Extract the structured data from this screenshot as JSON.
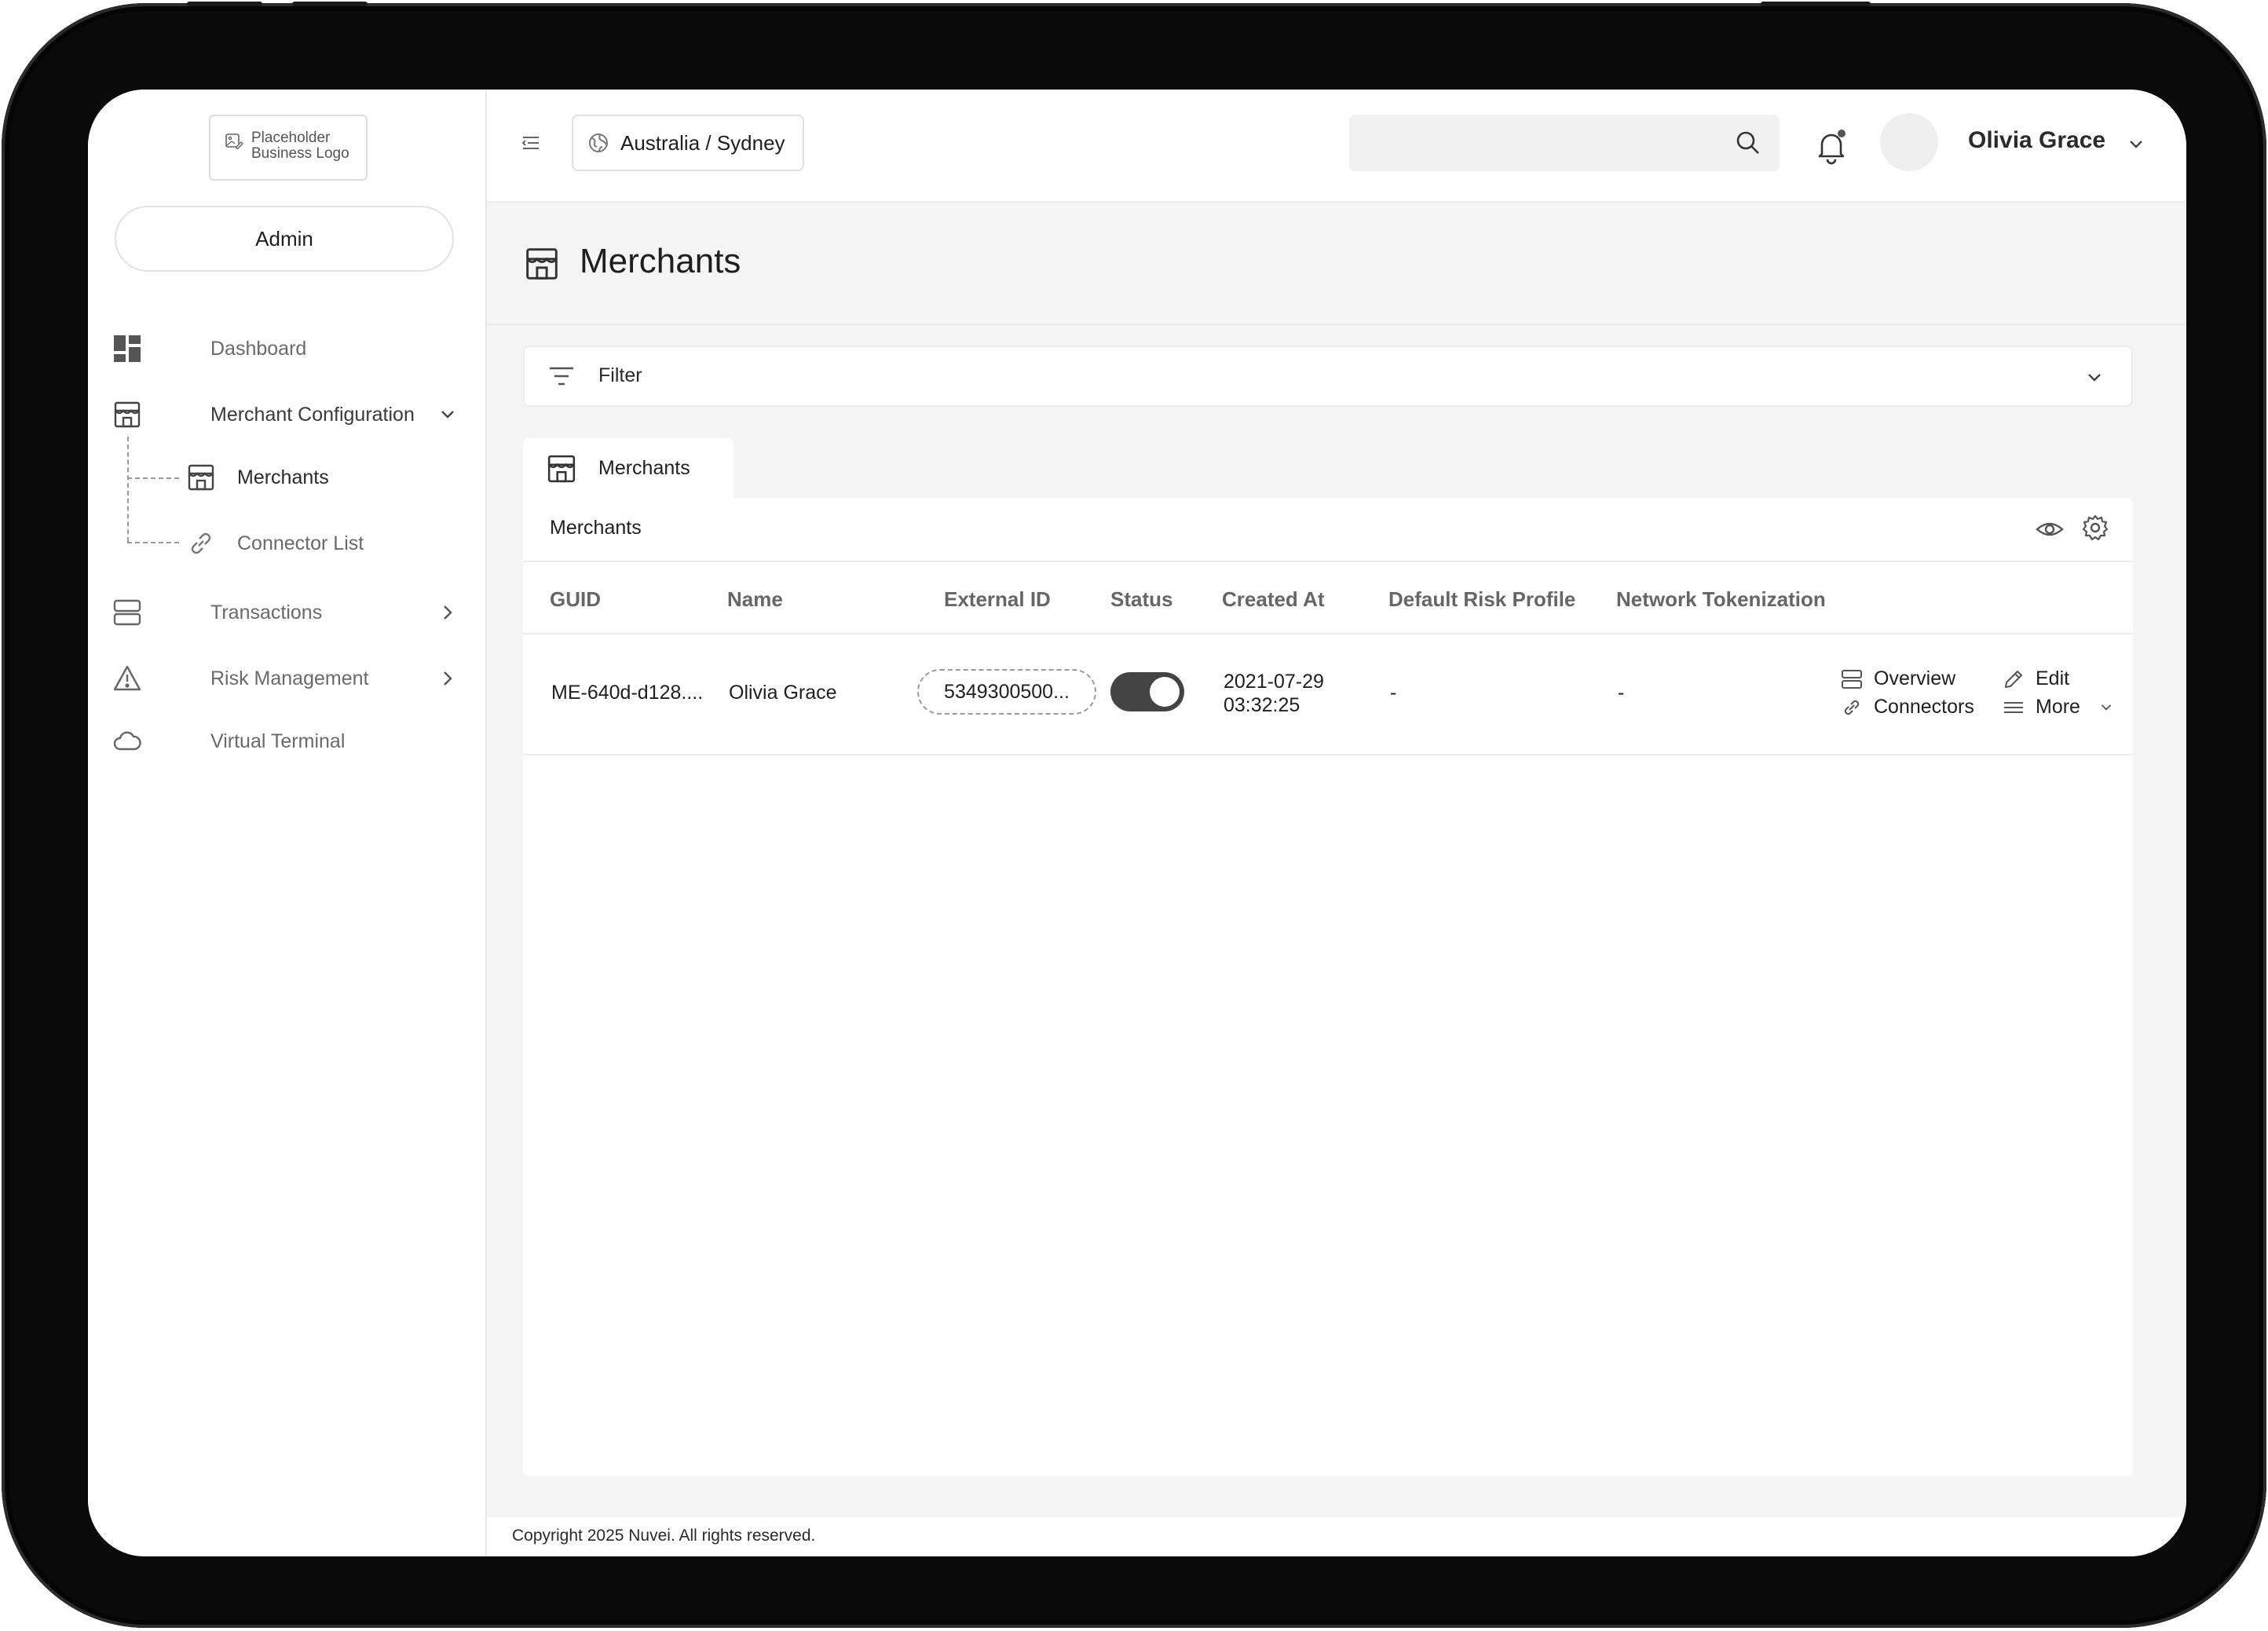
{
  "sidebar": {
    "logo_line1": "Placeholder",
    "logo_line2": "Business Logo",
    "role": "Admin",
    "items": [
      {
        "label": "Dashboard",
        "icon": "dashboard-icon"
      },
      {
        "label": "Merchant Configuration",
        "icon": "store-icon",
        "expanded": true,
        "children": [
          {
            "label": "Merchants",
            "icon": "store-icon",
            "active": true
          },
          {
            "label": "Connector List",
            "icon": "link-icon"
          }
        ]
      },
      {
        "label": "Transactions",
        "icon": "transactions-icon"
      },
      {
        "label": "Risk Management",
        "icon": "warning-icon"
      },
      {
        "label": "Virtual Terminal",
        "icon": "cloud-icon"
      }
    ]
  },
  "header": {
    "timezone": "Australia / Sydney",
    "search_value": "",
    "user_name": "Olivia Grace",
    "has_notification": true
  },
  "page": {
    "title": "Merchants",
    "filter_label": "Filter",
    "tab_label": "Merchants",
    "panel_title": "Merchants"
  },
  "table": {
    "columns": [
      "GUID",
      "Name",
      "External ID",
      "Status",
      "Created At",
      "Default Risk Profile",
      "Network Tokenization"
    ],
    "rows": [
      {
        "guid": "ME-640d-d128....",
        "name": "Olivia Grace",
        "external_id": "5349300500...",
        "status_on": true,
        "created_date": "2021-07-29",
        "created_time": "03:32:25",
        "default_risk_profile": "-",
        "network_tokenization": "-",
        "actions": {
          "overview": "Overview",
          "edit": "Edit",
          "connectors": "Connectors",
          "more": "More"
        }
      }
    ]
  },
  "footer": {
    "copyright": "Copyright 2025 Nuvei. All rights reserved."
  },
  "colors": {
    "frame": "#0a0a0a",
    "content_bg": "#f5f5f5",
    "toggle_on": "#444444"
  }
}
